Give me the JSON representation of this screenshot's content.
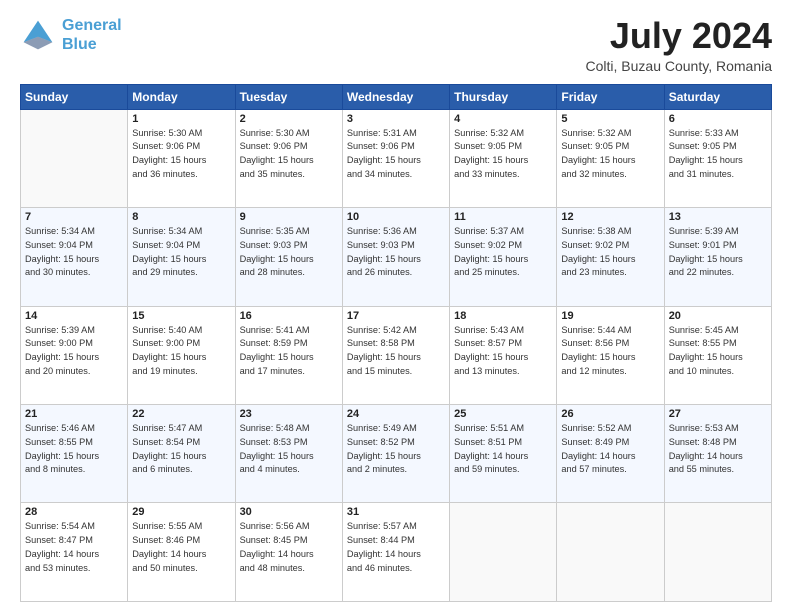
{
  "header": {
    "logo_line1": "General",
    "logo_line2": "Blue",
    "month": "July 2024",
    "location": "Colti, Buzau County, Romania"
  },
  "weekdays": [
    "Sunday",
    "Monday",
    "Tuesday",
    "Wednesday",
    "Thursday",
    "Friday",
    "Saturday"
  ],
  "weeks": [
    [
      {
        "day": "",
        "info": ""
      },
      {
        "day": "1",
        "info": "Sunrise: 5:30 AM\nSunset: 9:06 PM\nDaylight: 15 hours\nand 36 minutes."
      },
      {
        "day": "2",
        "info": "Sunrise: 5:30 AM\nSunset: 9:06 PM\nDaylight: 15 hours\nand 35 minutes."
      },
      {
        "day": "3",
        "info": "Sunrise: 5:31 AM\nSunset: 9:06 PM\nDaylight: 15 hours\nand 34 minutes."
      },
      {
        "day": "4",
        "info": "Sunrise: 5:32 AM\nSunset: 9:05 PM\nDaylight: 15 hours\nand 33 minutes."
      },
      {
        "day": "5",
        "info": "Sunrise: 5:32 AM\nSunset: 9:05 PM\nDaylight: 15 hours\nand 32 minutes."
      },
      {
        "day": "6",
        "info": "Sunrise: 5:33 AM\nSunset: 9:05 PM\nDaylight: 15 hours\nand 31 minutes."
      }
    ],
    [
      {
        "day": "7",
        "info": "Sunrise: 5:34 AM\nSunset: 9:04 PM\nDaylight: 15 hours\nand 30 minutes."
      },
      {
        "day": "8",
        "info": "Sunrise: 5:34 AM\nSunset: 9:04 PM\nDaylight: 15 hours\nand 29 minutes."
      },
      {
        "day": "9",
        "info": "Sunrise: 5:35 AM\nSunset: 9:03 PM\nDaylight: 15 hours\nand 28 minutes."
      },
      {
        "day": "10",
        "info": "Sunrise: 5:36 AM\nSunset: 9:03 PM\nDaylight: 15 hours\nand 26 minutes."
      },
      {
        "day": "11",
        "info": "Sunrise: 5:37 AM\nSunset: 9:02 PM\nDaylight: 15 hours\nand 25 minutes."
      },
      {
        "day": "12",
        "info": "Sunrise: 5:38 AM\nSunset: 9:02 PM\nDaylight: 15 hours\nand 23 minutes."
      },
      {
        "day": "13",
        "info": "Sunrise: 5:39 AM\nSunset: 9:01 PM\nDaylight: 15 hours\nand 22 minutes."
      }
    ],
    [
      {
        "day": "14",
        "info": "Sunrise: 5:39 AM\nSunset: 9:00 PM\nDaylight: 15 hours\nand 20 minutes."
      },
      {
        "day": "15",
        "info": "Sunrise: 5:40 AM\nSunset: 9:00 PM\nDaylight: 15 hours\nand 19 minutes."
      },
      {
        "day": "16",
        "info": "Sunrise: 5:41 AM\nSunset: 8:59 PM\nDaylight: 15 hours\nand 17 minutes."
      },
      {
        "day": "17",
        "info": "Sunrise: 5:42 AM\nSunset: 8:58 PM\nDaylight: 15 hours\nand 15 minutes."
      },
      {
        "day": "18",
        "info": "Sunrise: 5:43 AM\nSunset: 8:57 PM\nDaylight: 15 hours\nand 13 minutes."
      },
      {
        "day": "19",
        "info": "Sunrise: 5:44 AM\nSunset: 8:56 PM\nDaylight: 15 hours\nand 12 minutes."
      },
      {
        "day": "20",
        "info": "Sunrise: 5:45 AM\nSunset: 8:55 PM\nDaylight: 15 hours\nand 10 minutes."
      }
    ],
    [
      {
        "day": "21",
        "info": "Sunrise: 5:46 AM\nSunset: 8:55 PM\nDaylight: 15 hours\nand 8 minutes."
      },
      {
        "day": "22",
        "info": "Sunrise: 5:47 AM\nSunset: 8:54 PM\nDaylight: 15 hours\nand 6 minutes."
      },
      {
        "day": "23",
        "info": "Sunrise: 5:48 AM\nSunset: 8:53 PM\nDaylight: 15 hours\nand 4 minutes."
      },
      {
        "day": "24",
        "info": "Sunrise: 5:49 AM\nSunset: 8:52 PM\nDaylight: 15 hours\nand 2 minutes."
      },
      {
        "day": "25",
        "info": "Sunrise: 5:51 AM\nSunset: 8:51 PM\nDaylight: 14 hours\nand 59 minutes."
      },
      {
        "day": "26",
        "info": "Sunrise: 5:52 AM\nSunset: 8:49 PM\nDaylight: 14 hours\nand 57 minutes."
      },
      {
        "day": "27",
        "info": "Sunrise: 5:53 AM\nSunset: 8:48 PM\nDaylight: 14 hours\nand 55 minutes."
      }
    ],
    [
      {
        "day": "28",
        "info": "Sunrise: 5:54 AM\nSunset: 8:47 PM\nDaylight: 14 hours\nand 53 minutes."
      },
      {
        "day": "29",
        "info": "Sunrise: 5:55 AM\nSunset: 8:46 PM\nDaylight: 14 hours\nand 50 minutes."
      },
      {
        "day": "30",
        "info": "Sunrise: 5:56 AM\nSunset: 8:45 PM\nDaylight: 14 hours\nand 48 minutes."
      },
      {
        "day": "31",
        "info": "Sunrise: 5:57 AM\nSunset: 8:44 PM\nDaylight: 14 hours\nand 46 minutes."
      },
      {
        "day": "",
        "info": ""
      },
      {
        "day": "",
        "info": ""
      },
      {
        "day": "",
        "info": ""
      }
    ]
  ]
}
